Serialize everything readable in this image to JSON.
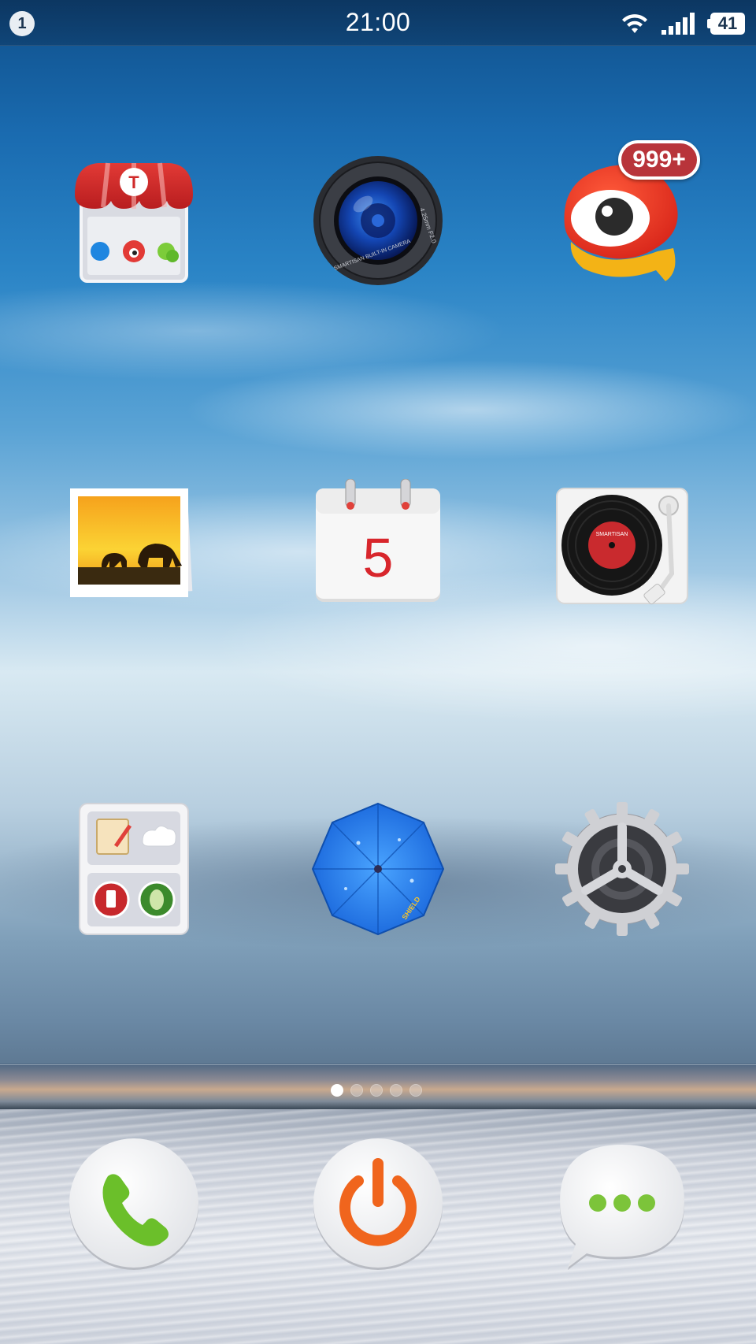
{
  "status_bar": {
    "notification_count": "1",
    "time": "21:00",
    "wifi_icon": "wifi-icon",
    "signal_icon": "cellular-signal-icon",
    "battery_level": "41"
  },
  "home_grid": {
    "apps": [
      {
        "icon": "app-store-icon",
        "badge": ""
      },
      {
        "icon": "camera-icon",
        "badge": ""
      },
      {
        "icon": "weibo-icon",
        "badge": "999+"
      },
      {
        "icon": "gallery-icon",
        "badge": ""
      },
      {
        "icon": "calendar-icon",
        "badge": "",
        "day": "5"
      },
      {
        "icon": "music-player-icon",
        "badge": ""
      },
      {
        "icon": "tools-folder-icon",
        "badge": ""
      },
      {
        "icon": "security-shield-umbrella-icon",
        "badge": ""
      },
      {
        "icon": "settings-gear-icon",
        "badge": ""
      }
    ],
    "camera_lens_text": "4.25mm F2.0 · SMARTISAN BUILT-IN CAMERA",
    "record_label": "SMARTISAN",
    "umbrella_label": "SHIELD"
  },
  "pager": {
    "page_count": 5,
    "active_page": 1
  },
  "dock": {
    "items": [
      {
        "icon": "phone-icon"
      },
      {
        "icon": "power-icon"
      },
      {
        "icon": "messages-icon"
      }
    ]
  },
  "colors": {
    "sky_top": "#0f4f8a",
    "badge_red": "#b8343a",
    "phone_green": "#6bbf2a",
    "power_orange": "#f0651d",
    "message_green": "#7cc43a"
  }
}
